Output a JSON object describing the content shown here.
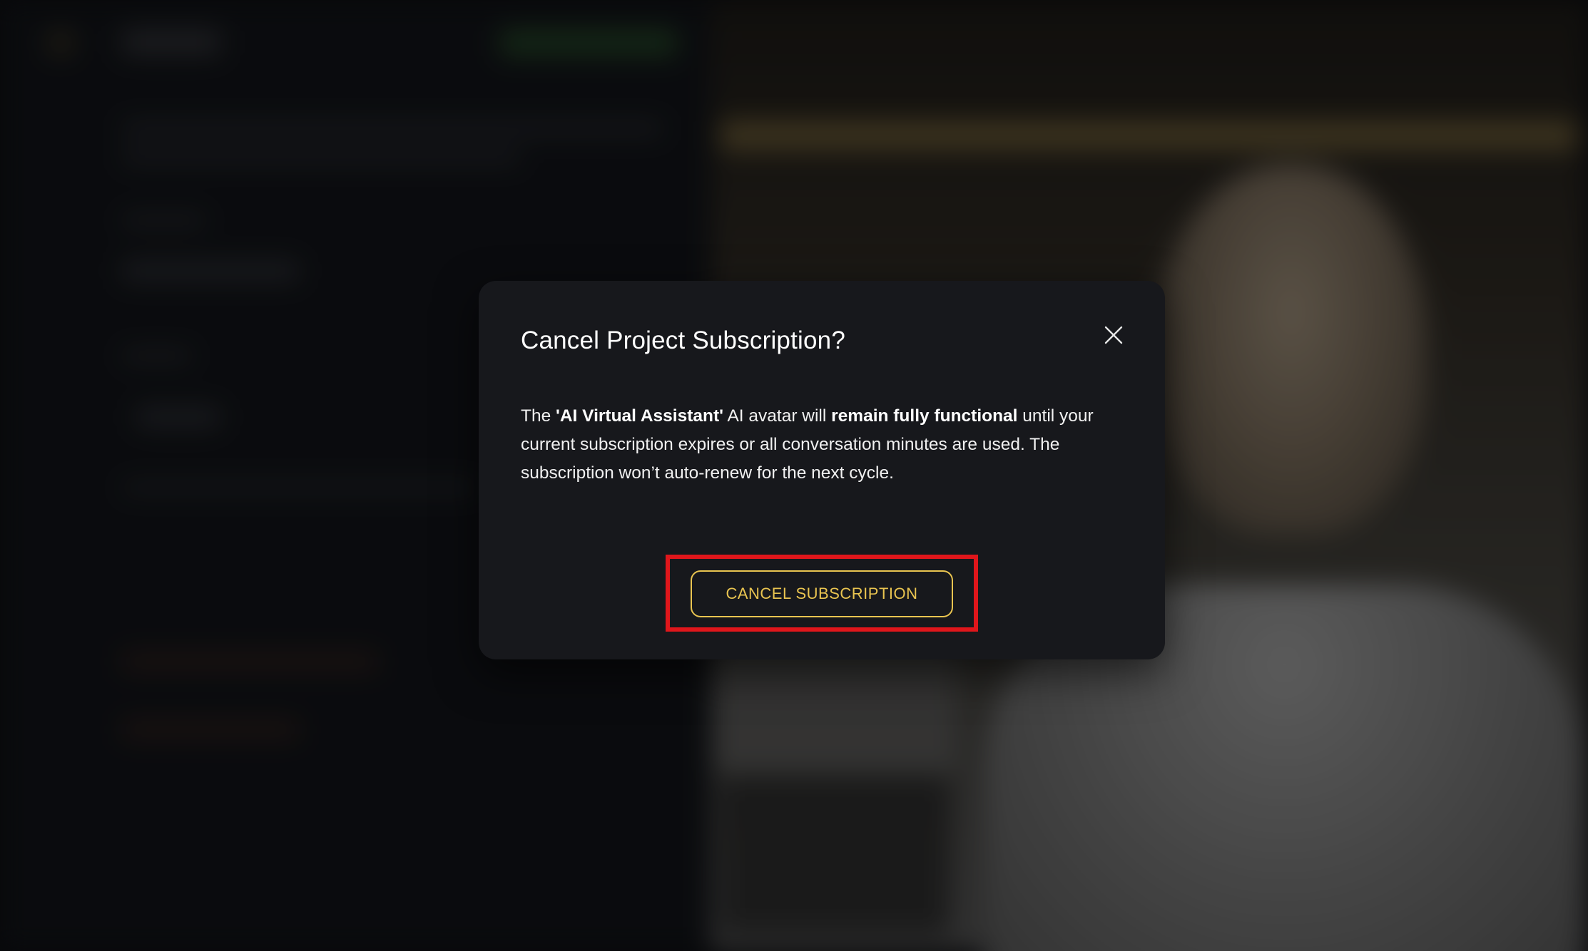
{
  "dialog": {
    "title": "Cancel Project Subscription?",
    "close_icon": "close-icon",
    "body": {
      "p1": "The ",
      "project_name": "'AI Virtual Assistant'",
      "p2": " AI avatar will ",
      "emphasis": "remain fully functional",
      "p3": " until your current subscription expires or all conversation minutes are used. The subscription won’t auto-renew for the next cycle."
    },
    "cancel_button_label": "CANCEL SUBSCRIPTION"
  },
  "colors": {
    "modal_background": "#17181c",
    "accent_gold": "#e9c450",
    "highlight_red": "#e0161b",
    "page_background": "#0c0d10"
  }
}
